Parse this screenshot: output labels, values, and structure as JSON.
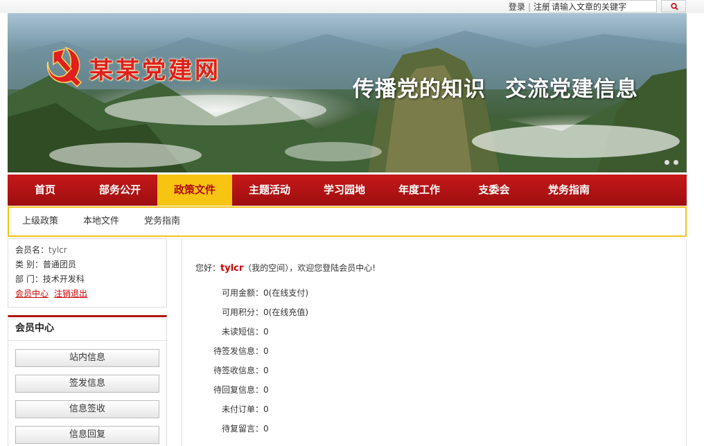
{
  "topbar": {
    "login": "登录",
    "register": "注册",
    "search_placeholder": "请输入文章的关键字"
  },
  "banner": {
    "site_name": "某某党建网",
    "slogan_left": "传播党的知识",
    "slogan_right": "交流党建信息"
  },
  "nav": {
    "items": [
      "首页",
      "部务公开",
      "政策文件",
      "主题活动",
      "学习园地",
      "年度工作",
      "支委会",
      "党务指南"
    ],
    "active_index": 2
  },
  "subnav": {
    "items": [
      "上级政策",
      "本地文件",
      "党务指南"
    ]
  },
  "user": {
    "name_label": "会员名：",
    "name_value": "tylcr",
    "type_label": "类 别：",
    "type_value": "普通团员",
    "dept_label": "部 门：",
    "dept_value": "技术开发科",
    "link_member": "会员中心",
    "link_logout": "注销退出"
  },
  "member_center": {
    "title": "会员中心",
    "buttons": [
      "站内信息",
      "签发信息",
      "信息签收",
      "信息回复"
    ]
  },
  "content": {
    "greeting_prefix": "您好：",
    "username": "tylcr",
    "my_space": "（我的空间）",
    "greeting_suffix": "，欢迎您登陆会员中心!",
    "rows": [
      {
        "label": "可用金额：",
        "value": "0",
        "extra": "(在线支付)"
      },
      {
        "label": "可用积分：",
        "value": "0",
        "extra": "(在线充值)"
      },
      {
        "label": "未读短信：",
        "value": "0",
        "extra": ""
      },
      {
        "label": "待签发信息：",
        "value": "0",
        "extra": ""
      },
      {
        "label": "待签收信息：",
        "value": "0",
        "extra": ""
      },
      {
        "label": "待回复信息：",
        "value": "0",
        "extra": ""
      },
      {
        "label": "未付订单：",
        "value": "0",
        "extra": ""
      },
      {
        "label": "待复留言：",
        "value": "0",
        "extra": ""
      }
    ]
  },
  "colors": {
    "nav_red": "#b41213",
    "nav_active": "#f7c411",
    "link_red": "#cc0000"
  }
}
